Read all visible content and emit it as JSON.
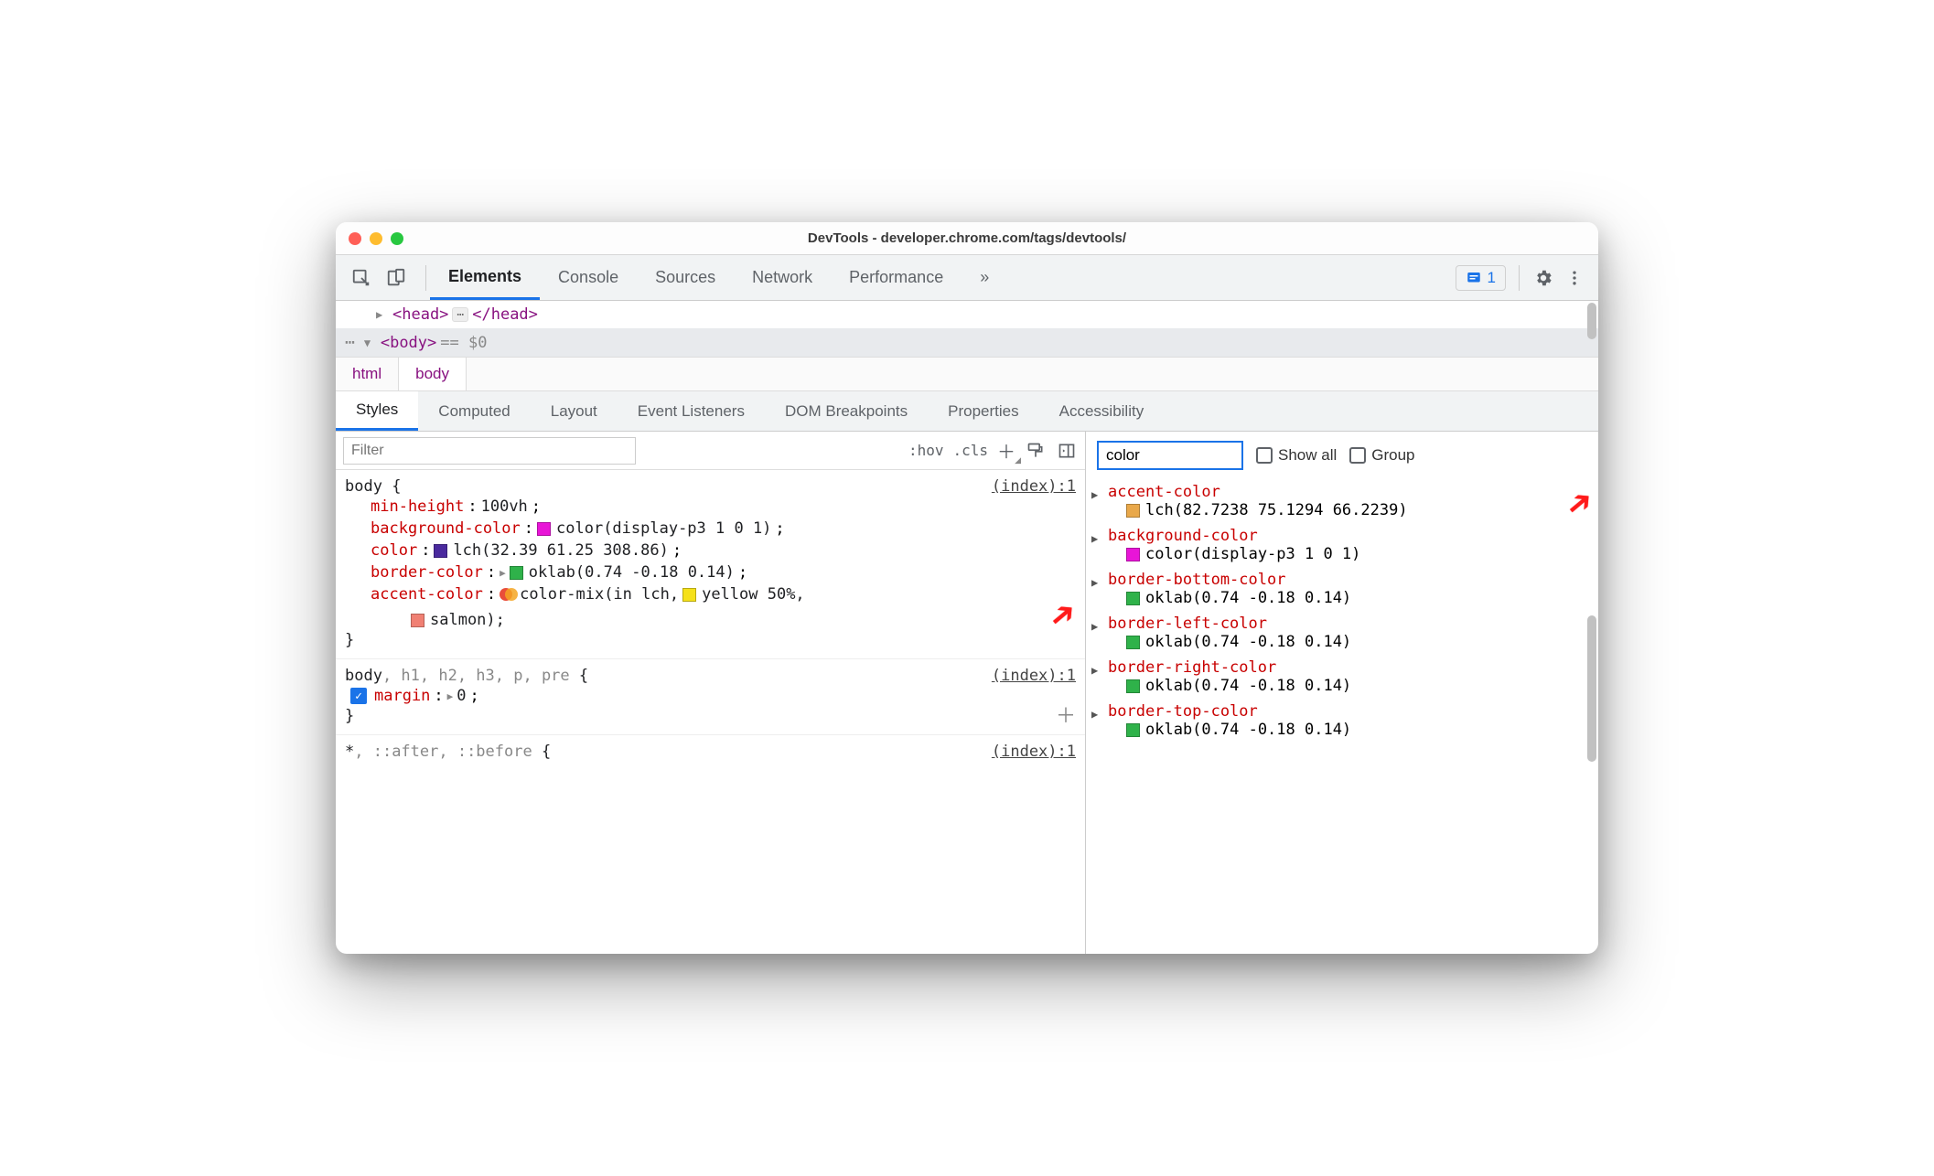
{
  "window": {
    "title": "DevTools - developer.chrome.com/tags/devtools/"
  },
  "mainTabs": [
    "Elements",
    "Console",
    "Sources",
    "Network",
    "Performance"
  ],
  "activeMainTab": "Elements",
  "overflowGlyph": "»",
  "issuesCount": "1",
  "dom": {
    "head_open": "<head>",
    "head_close": "</head>",
    "body_open": "<body>",
    "eq": "== $0"
  },
  "breadcrumbs": [
    "html",
    "body"
  ],
  "subTabs": [
    "Styles",
    "Computed",
    "Layout",
    "Event Listeners",
    "DOM Breakpoints",
    "Properties",
    "Accessibility"
  ],
  "activeSubTab": "Styles",
  "stylesToolbar": {
    "filterPlaceholder": "Filter",
    "hov": ":hov",
    "cls": ".cls"
  },
  "rules": [
    {
      "selector": "body",
      "source": "(index):1",
      "props": [
        {
          "type": "plain",
          "name": "min-height",
          "value": "100vh"
        },
        {
          "type": "swatch",
          "name": "background-color",
          "swatch": "#e815d7",
          "value": "color(display-p3 1 0 1)"
        },
        {
          "type": "swatch",
          "name": "color",
          "swatch": "#4a2a9e",
          "value": "lch(32.39 61.25 308.86)"
        },
        {
          "type": "swatch-expand",
          "name": "border-color",
          "swatch": "#2fb24a",
          "value": "oklab(0.74 -0.18 0.14)"
        },
        {
          "type": "mix",
          "name": "accent-color",
          "parts": {
            "prefix": "color-mix(in lch, ",
            "sw1": "#f5e11a",
            "txt1": "yellow 50%,",
            "sw2": "#f08073",
            "txt2": "salmon);"
          }
        }
      ]
    },
    {
      "selector": "body, h1, h2, h3, p, pre",
      "source": "(index):1",
      "props": [
        {
          "type": "checked-expand",
          "name": "margin",
          "value": "0"
        }
      ]
    },
    {
      "selector": "*, ::after, ::before",
      "source": "(index):1",
      "props": []
    }
  ],
  "computed": {
    "filterValue": "color",
    "showAll": "Show all",
    "group": "Group",
    "rows": [
      {
        "name": "accent-color",
        "swatch": "#e9a84a",
        "value": "lch(82.7238 75.1294 66.2239)"
      },
      {
        "name": "background-color",
        "swatch": "#e815d7",
        "value": "color(display-p3 1 0 1)"
      },
      {
        "name": "border-bottom-color",
        "swatch": "#2fb24a",
        "value": "oklab(0.74 -0.18 0.14)"
      },
      {
        "name": "border-left-color",
        "swatch": "#2fb24a",
        "value": "oklab(0.74 -0.18 0.14)"
      },
      {
        "name": "border-right-color",
        "swatch": "#2fb24a",
        "value": "oklab(0.74 -0.18 0.14)"
      },
      {
        "name": "border-top-color",
        "swatch": "#2fb24a",
        "value": "oklab(0.74 -0.18 0.14)"
      }
    ]
  }
}
